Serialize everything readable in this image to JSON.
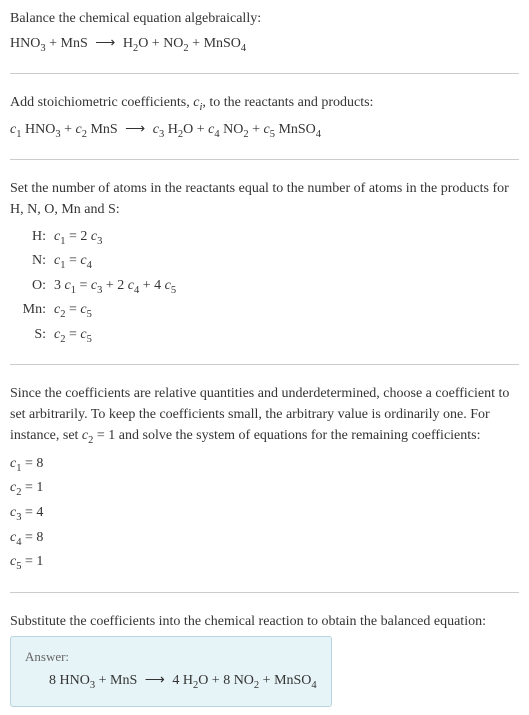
{
  "section1": {
    "prompt": "Balance the chemical equation algebraically:",
    "eq": {
      "lhs1": "HNO",
      "lhs1sub": "3",
      "plus1": " + MnS ",
      "arrow": "⟶",
      "rhs1": " H",
      "rhs1sub": "2",
      "rhs2": "O + NO",
      "rhs2sub": "2",
      "rhs3": " + MnSO",
      "rhs3sub": "4"
    }
  },
  "section2": {
    "prompt_a": "Add stoichiometric coefficients, ",
    "ci": "c",
    "ci_sub": "i",
    "prompt_b": ", to the reactants and products:",
    "eq": {
      "c1": "c",
      "c1sub": "1",
      "sp1": " HNO",
      "sp1sub": "3",
      "p1": " + ",
      "c2": "c",
      "c2sub": "2",
      "sp2": " MnS ",
      "arrow": "⟶",
      "sp3a": " ",
      "c3": "c",
      "c3sub": "3",
      "sp3": " H",
      "sp3sub": "2",
      "sp3b": "O + ",
      "c4": "c",
      "c4sub": "4",
      "sp4": " NO",
      "sp4sub": "2",
      "p4": " + ",
      "c5": "c",
      "c5sub": "5",
      "sp5": " MnSO",
      "sp5sub": "4"
    }
  },
  "section3": {
    "prompt": "Set the number of atoms in the reactants equal to the number of atoms in the products for H, N, O, Mn and S:",
    "rows": {
      "H_label": "H:",
      "H_eq_a": "c",
      "H_eq_asub": "1",
      "H_eq_b": " = 2 ",
      "H_eq_c": "c",
      "H_eq_csub": "3",
      "N_label": "N:",
      "N_eq_a": "c",
      "N_eq_asub": "1",
      "N_eq_b": " = ",
      "N_eq_c": "c",
      "N_eq_csub": "4",
      "O_label": "O:",
      "O_eq_a": "3 ",
      "O_eq_b": "c",
      "O_eq_bsub": "1",
      "O_eq_c": " = ",
      "O_eq_d": "c",
      "O_eq_dsub": "3",
      "O_eq_e": " + 2 ",
      "O_eq_f": "c",
      "O_eq_fsub": "4",
      "O_eq_g": " + 4 ",
      "O_eq_h": "c",
      "O_eq_hsub": "5",
      "Mn_label": "Mn:",
      "Mn_eq_a": "c",
      "Mn_eq_asub": "2",
      "Mn_eq_b": " = ",
      "Mn_eq_c": "c",
      "Mn_eq_csub": "5",
      "S_label": "S:",
      "S_eq_a": "c",
      "S_eq_asub": "2",
      "S_eq_b": " = ",
      "S_eq_c": "c",
      "S_eq_csub": "5"
    }
  },
  "section4": {
    "prompt_a": "Since the coefficients are relative quantities and underdetermined, choose a coefficient to set arbitrarily. To keep the coefficients small, the arbitrary value is ordinarily one. For instance, set ",
    "c2": "c",
    "c2sub": "2",
    "prompt_b": " = 1 and solve the system of equations for the remaining coefficients:",
    "coeffs": {
      "l1a": "c",
      "l1sub": "1",
      "l1b": " = 8",
      "l2a": "c",
      "l2sub": "2",
      "l2b": " = 1",
      "l3a": "c",
      "l3sub": "3",
      "l3b": " = 4",
      "l4a": "c",
      "l4sub": "4",
      "l4b": " = 8",
      "l5a": "c",
      "l5sub": "5",
      "l5b": " = 1"
    }
  },
  "section5": {
    "prompt": "Substitute the coefficients into the chemical reaction to obtain the balanced equation:",
    "answer_label": "Answer:",
    "eq": {
      "a": "8 HNO",
      "asub": "3",
      "b": " + MnS ",
      "arrow": "⟶",
      "c": " 4 H",
      "csub": "2",
      "d": "O + 8 NO",
      "dsub": "2",
      "e": " + MnSO",
      "esub": "4"
    }
  }
}
